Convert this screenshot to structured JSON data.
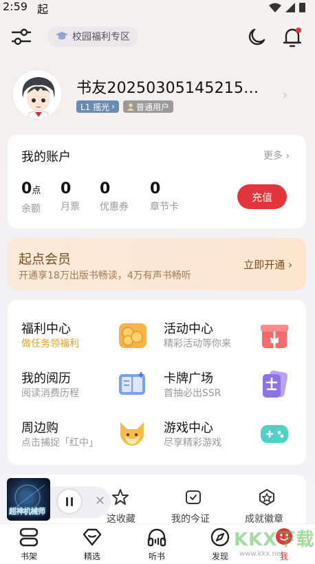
{
  "status": {
    "time": "2:59",
    "app_glyph": "起"
  },
  "topbar": {
    "campus_label": "校园福利专区"
  },
  "profile": {
    "username": "书友20250305145215…",
    "level_badge": "L1 摇光",
    "user_badge": "普通用户"
  },
  "account": {
    "title": "我的账户",
    "more": "更多",
    "stats": [
      {
        "value": "0",
        "unit": "点",
        "label": "余额"
      },
      {
        "value": "0",
        "unit": "",
        "label": "月票"
      },
      {
        "value": "0",
        "unit": "",
        "label": "优惠券"
      },
      {
        "value": "0",
        "unit": "",
        "label": "章节卡"
      }
    ],
    "recharge": "充值"
  },
  "vip": {
    "title": "起点会员",
    "subtitle": "开通享18万出版书畅读，4万有声书畅听",
    "button": "立即开通"
  },
  "grid": [
    {
      "title": "福利中心",
      "subtitle": "做任务领福利",
      "icon": "coins-icon"
    },
    {
      "title": "活动中心",
      "subtitle": "精彩活动等你来",
      "icon": "gift-icon"
    },
    {
      "title": "我的阅历",
      "subtitle": "阅读消费历程",
      "icon": "book-icon"
    },
    {
      "title": "卡牌广场",
      "subtitle": "首抽必出SSR",
      "icon": "card-icon"
    },
    {
      "title": "周边购",
      "subtitle": "点击捕捉「红中」",
      "icon": "fox-icon"
    },
    {
      "title": "游戏中心",
      "subtitle": "尽享精彩游戏",
      "icon": "gamepad-icon"
    }
  ],
  "bottom_card": {
    "items": [
      "这收藏",
      "我的今证",
      "成就徽章"
    ]
  },
  "player": {
    "cover_text": "超神机械师"
  },
  "tabbar": [
    {
      "label": "书架",
      "icon": "bookshelf-icon"
    },
    {
      "label": "精选",
      "icon": "diamond-icon"
    },
    {
      "label": "听书",
      "icon": "headphones-icon"
    },
    {
      "label": "发现",
      "icon": "compass-icon"
    },
    {
      "label": "我",
      "icon": "me-icon"
    }
  ],
  "watermark": {
    "brand": "KKX下载",
    "url": "www.kkx.net"
  },
  "colors": {
    "accent": "#e3363b",
    "vip_text": "#7a4a1f",
    "welfare_orange": "#e5a21a"
  }
}
